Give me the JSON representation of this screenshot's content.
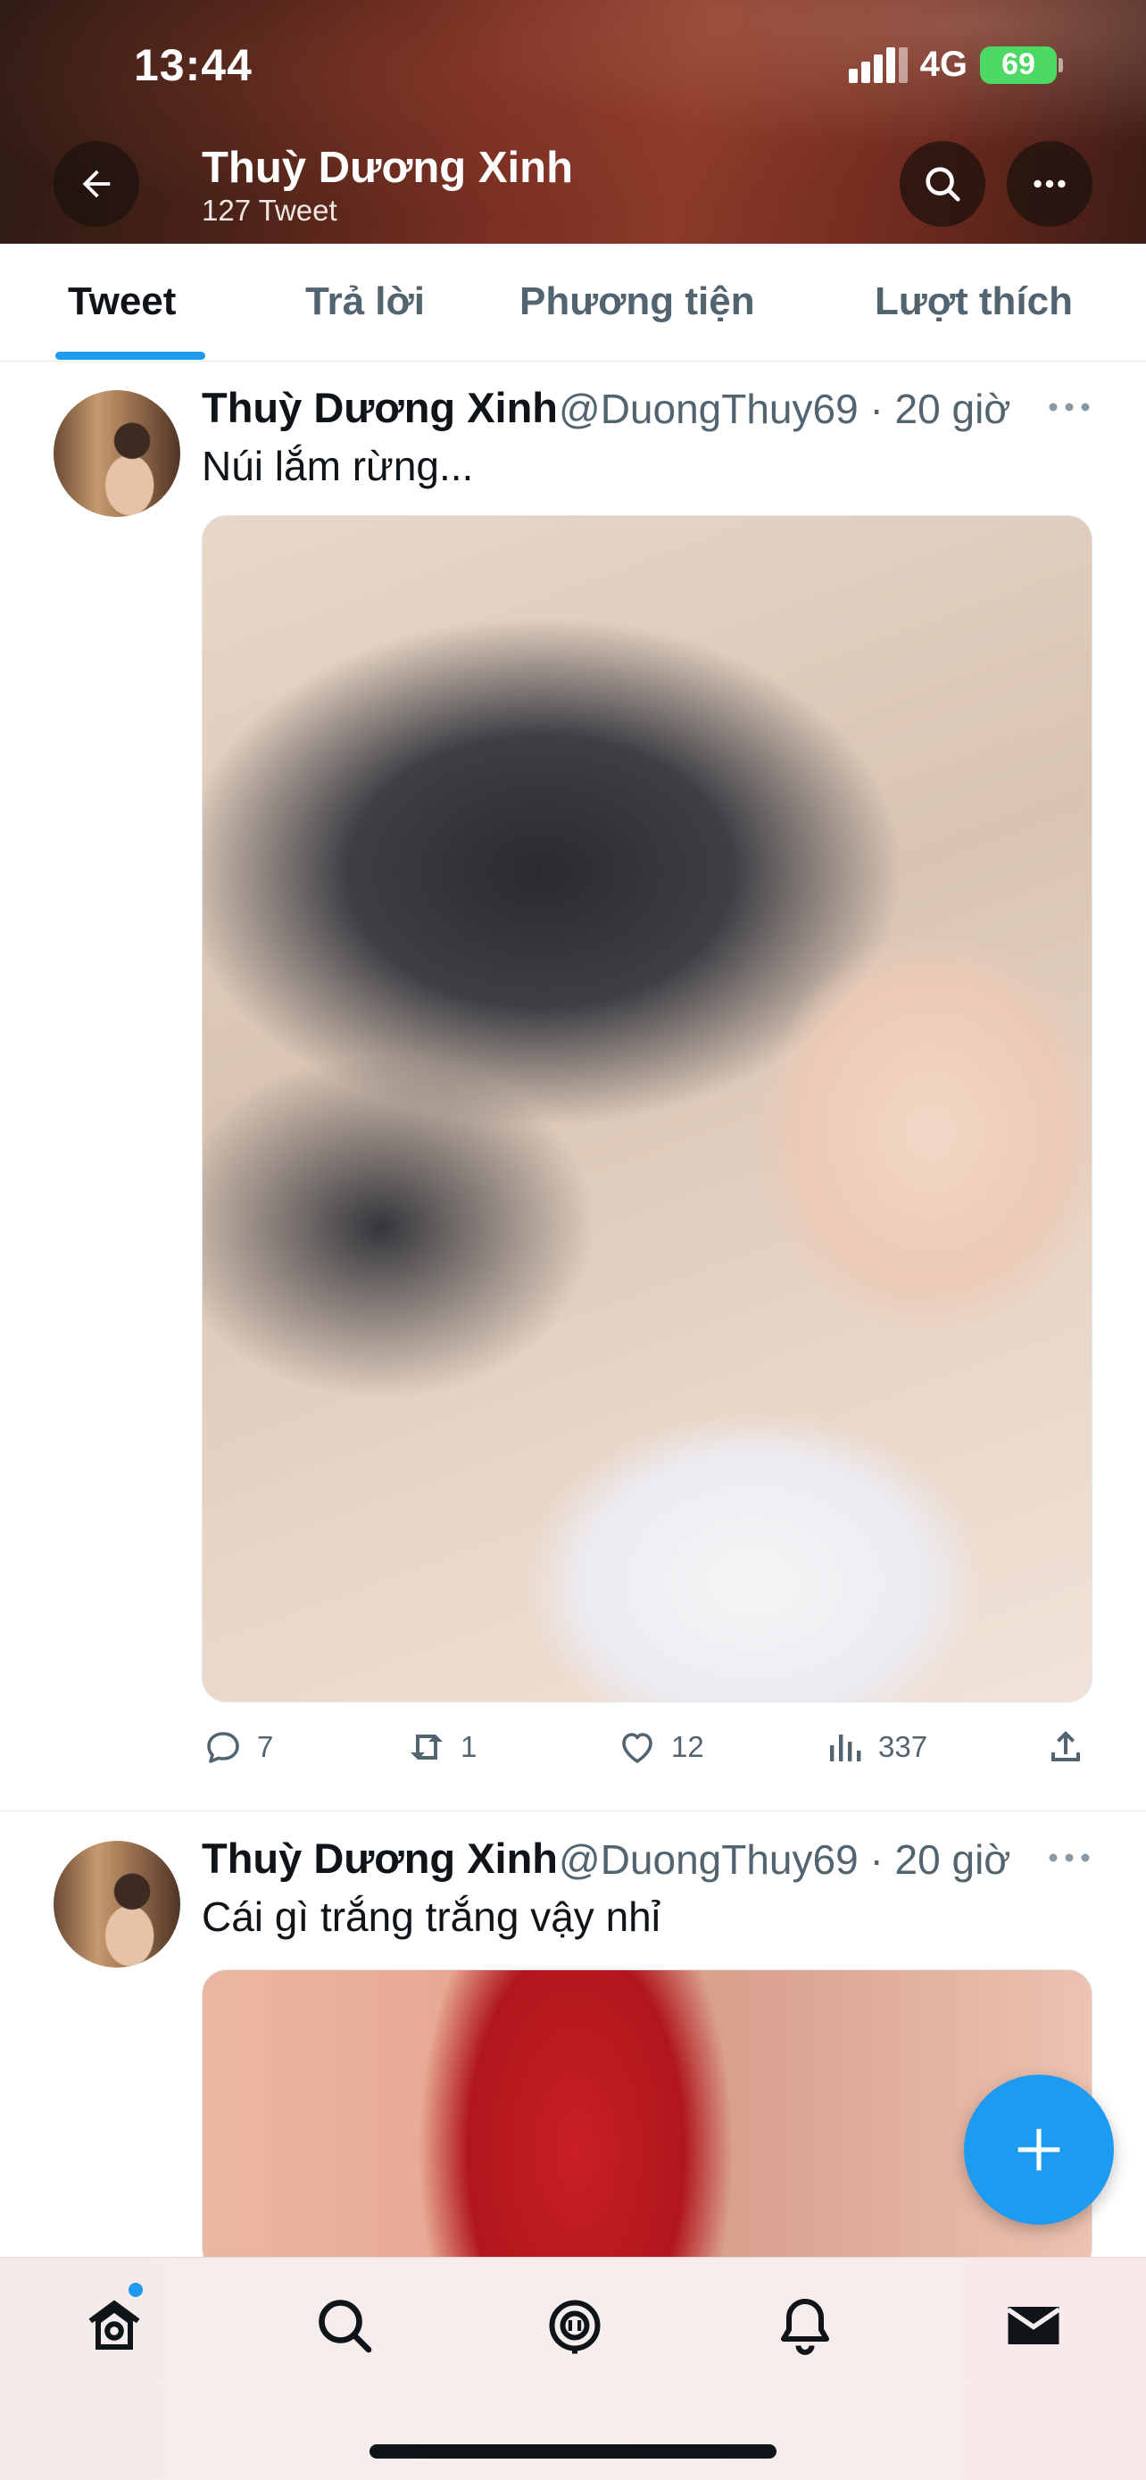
{
  "status_bar": {
    "time": "13:44",
    "network": "4G",
    "battery": "69"
  },
  "header": {
    "name": "Thuỳ Dương Xinh",
    "tweet_count": "127 Tweet",
    "back_icon": "arrow-left-icon",
    "search_icon": "search-icon",
    "more_icon": "more-dots-icon"
  },
  "tabs": [
    {
      "label": "Tweet",
      "active": true
    },
    {
      "label": "Trả lời",
      "active": false
    },
    {
      "label": "Phương tiện",
      "active": false
    },
    {
      "label": "Lượt thích",
      "active": false
    }
  ],
  "tweets": [
    {
      "name": "Thuỳ Dương Xinh",
      "handle_time": "@DuongThuy69 · 20 giờ",
      "text": "Núi lắm rừng...",
      "replies": "7",
      "retweets": "1",
      "likes": "12",
      "views": "337"
    },
    {
      "name": "Thuỳ Dương Xinh",
      "handle_time": "@DuongThuy69 · 20 giờ",
      "text": "Cái gì trắng trắng vậy nhỉ"
    }
  ],
  "colors": {
    "accent": "#1d9bf0",
    "text_primary": "#0f1419",
    "text_secondary": "#536471"
  },
  "bottom_nav": [
    {
      "icon": "home-icon",
      "active": true
    },
    {
      "icon": "search-icon"
    },
    {
      "icon": "spaces-mic-icon"
    },
    {
      "icon": "bell-icon"
    },
    {
      "icon": "mail-icon"
    }
  ]
}
